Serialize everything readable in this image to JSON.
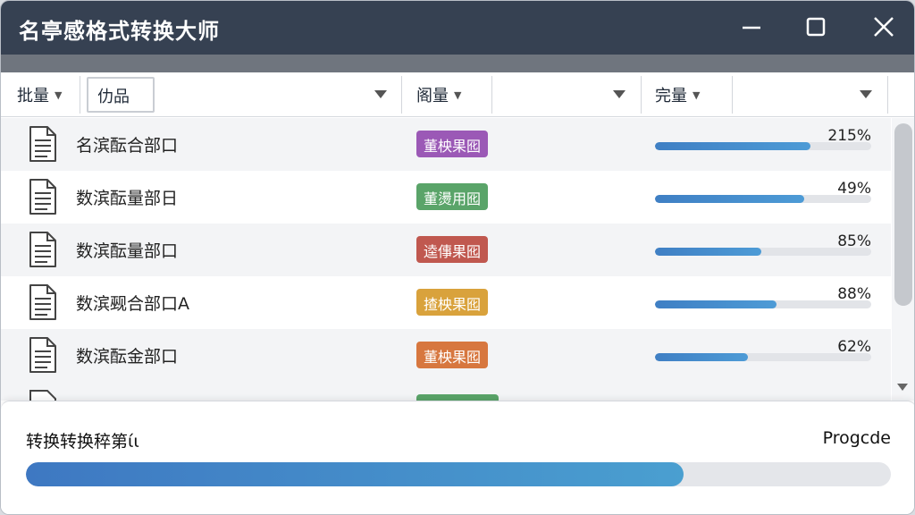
{
  "window": {
    "title": "名亭感格式转换大师"
  },
  "header": {
    "col1_label": "批量",
    "search_value": "仂品",
    "col2_label": "阁量",
    "col3_label": "完量"
  },
  "colors": {
    "titlebar": "#364152",
    "progress": "#4287c9",
    "tag_purple": "#9b59b6",
    "tag_green": "#5aa469",
    "tag_red": "#c0584f",
    "tag_amber": "#d9a23c",
    "tag_orange": "#d7773f"
  },
  "rows": [
    {
      "name": "名滨酝合部口",
      "tag": "董柍果囮",
      "tag_color": "#9b59b6",
      "percent_label": "215%",
      "progress": 0.72
    },
    {
      "name": "数滨酝量部日",
      "tag": "董燙用囮",
      "tag_color": "#5aa469",
      "percent_label": "49%",
      "progress": 0.69
    },
    {
      "name": "数滨酝量部口",
      "tag": "逵倳果囮",
      "tag_color": "#c0584f",
      "percent_label": "85%",
      "progress": 0.49
    },
    {
      "name": "数滨觋合部口A",
      "tag": "揸柍果囮",
      "tag_color": "#d9a23c",
      "percent_label": "88%",
      "progress": 0.56
    },
    {
      "name": "数滨酝金部口",
      "tag": "董柍果囮",
      "tag_color": "#d7773f",
      "percent_label": "62%",
      "progress": 0.43
    }
  ],
  "footer": {
    "label": "转换转换稡第ίι",
    "right_label": "Progcde",
    "progress": 0.76
  }
}
